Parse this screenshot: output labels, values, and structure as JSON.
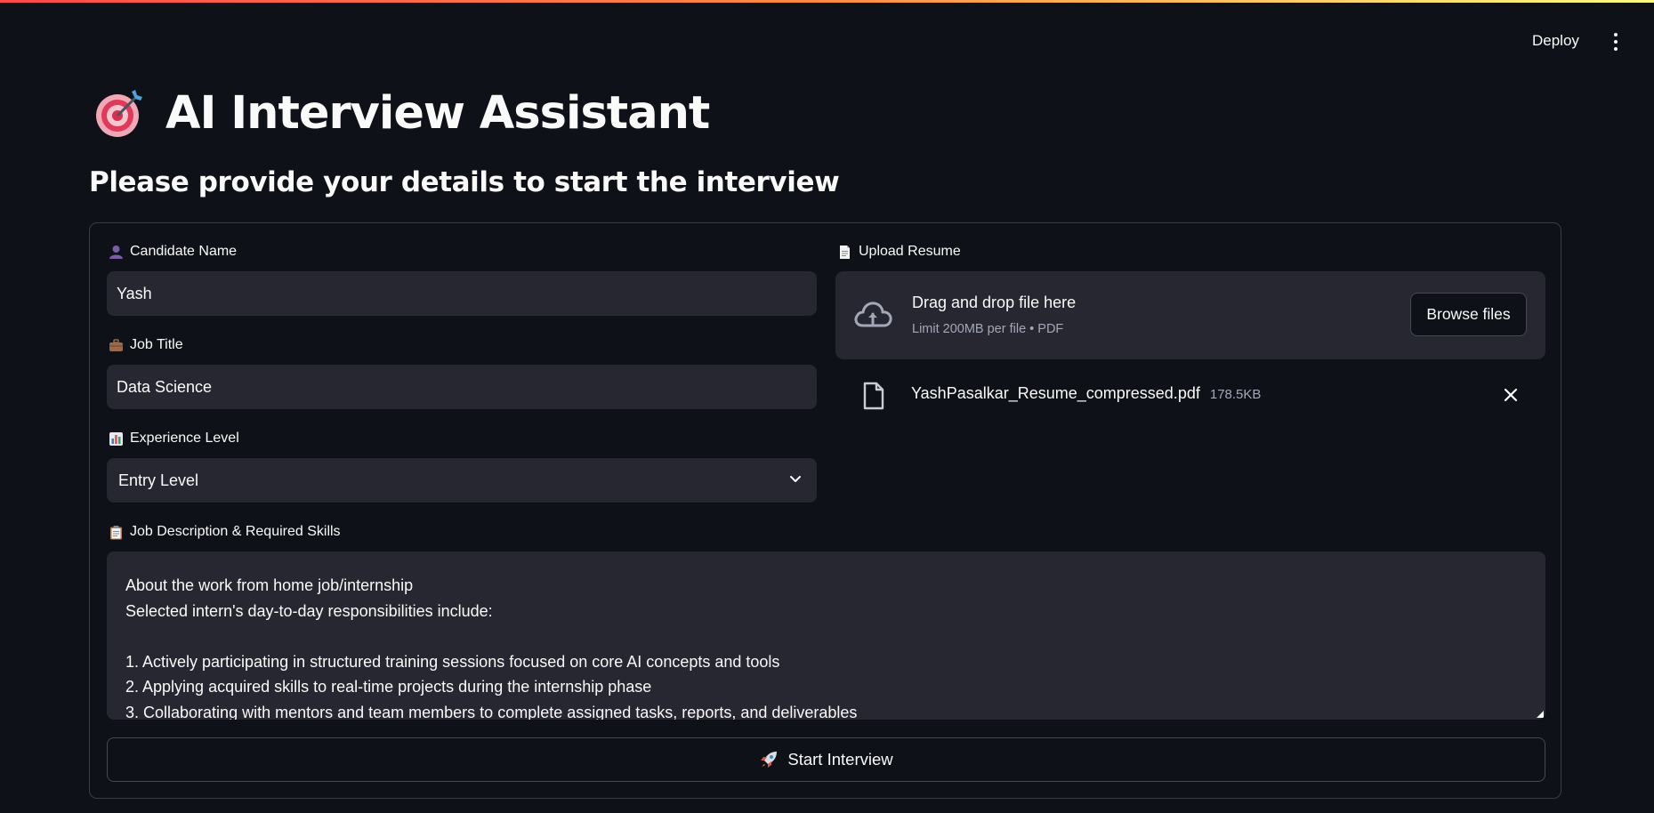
{
  "header": {
    "deploy_label": "Deploy",
    "menu_icon": "vertical-dots-icon"
  },
  "page": {
    "title_icon": "direct-hit-target-icon",
    "title": "AI Interview Assistant",
    "subtitle": "Please provide your details to start the interview"
  },
  "form": {
    "candidate_name": {
      "icon": "person-silhouette-icon",
      "label": "Candidate Name",
      "value": "Yash"
    },
    "job_title": {
      "icon": "briefcase-icon",
      "label": "Job Title",
      "value": "Data Science"
    },
    "experience_level": {
      "icon": "bar-chart-icon",
      "label": "Experience Level",
      "selected": "Entry Level"
    },
    "resume": {
      "icon": "document-icon",
      "label": "Upload Resume",
      "dropzone_text": "Drag and drop file here",
      "dropzone_hint": "Limit 200MB per file • PDF",
      "browse_label": "Browse files",
      "file_name": "YashPasalkar_Resume_compressed.pdf",
      "file_size": "178.5KB"
    },
    "job_description": {
      "icon": "clipboard-icon",
      "label": "Job Description & Required Skills",
      "lines": [
        "About the work from home job/internship",
        "Selected intern's day-to-day responsibilities include:",
        "",
        "1. Actively participating in structured training sessions focused on core AI concepts and tools",
        "2. Applying acquired skills to real-time projects during the internship phase",
        "3. Collaborating with mentors and team members to complete assigned tasks, reports, and deliverables"
      ]
    },
    "submit": {
      "icon": "rocket-icon",
      "label": "Start Interview"
    }
  },
  "colors": {
    "background": "#0e1117",
    "input_bg": "#262730",
    "border": "#3a3d47",
    "muted_text": "#a3a8b8",
    "accent_gradient_start": "#ff4b4b",
    "accent_gradient_end": "#fffd80"
  }
}
